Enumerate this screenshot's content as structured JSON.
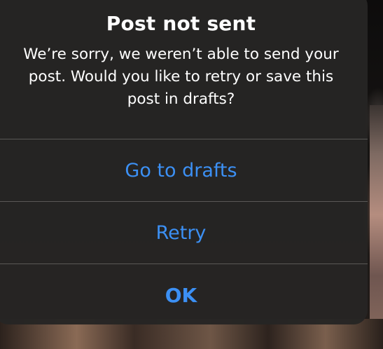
{
  "alert": {
    "title": "Post not sent",
    "message": "We’re sorry, we weren’t able to send your post. Would you like to retry or save this post in drafts?",
    "actions": [
      {
        "label": "Go to drafts"
      },
      {
        "label": "Retry"
      },
      {
        "label": "OK"
      }
    ]
  },
  "colors": {
    "action_blue": "#3c90f4",
    "alert_background": "#262524"
  }
}
